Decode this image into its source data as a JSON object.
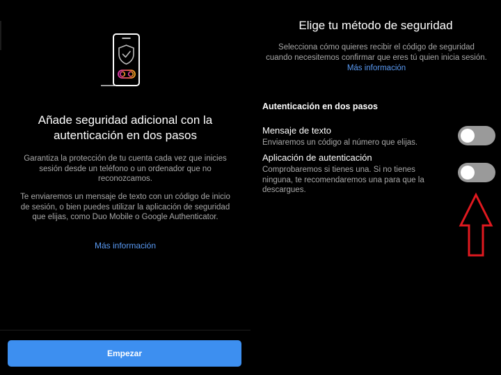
{
  "left": {
    "title": "Añade seguridad adicional con la autenticación en dos pasos",
    "paragraph_1": "Garantiza la protección de tu cuenta cada vez que inicies sesión desde un teléfono o un ordenador que no reconozcamos.",
    "paragraph_2": "Te enviaremos un mensaje de texto con un código de inicio de sesión, o bien puedes utilizar la aplicación de seguridad que elijas, como Duo Mobile o Google Authenticator.",
    "more_info_link": "Más información",
    "start_button": "Empezar",
    "illustration_icon": "phone-shield-icon"
  },
  "right": {
    "title": "Elige tu método de seguridad",
    "subtitle": "Selecciona cómo quieres recibir el código de seguridad cuando necesitemos confirmar que eres tú quien inicia sesión.",
    "more_info_link": "Más información",
    "section_heading": "Autenticación en dos pasos",
    "options": [
      {
        "title": "Mensaje de texto",
        "description": "Enviaremos un código al número que elijas.",
        "enabled": false
      },
      {
        "title": "Aplicación de autenticación",
        "description": "Comprobaremos si tienes una. Si no tienes ninguna, te recomendaremos una para que la descargues.",
        "enabled": false
      }
    ],
    "annotation_icon": "red-arrow-up-icon"
  },
  "colors": {
    "background": "#000000",
    "primary_button": "#3d8ff0",
    "link": "#5a9bf5",
    "secondary_text": "#a8a8a8",
    "toggle_off": "#9a9a9a",
    "annotation": "#e0191f"
  }
}
